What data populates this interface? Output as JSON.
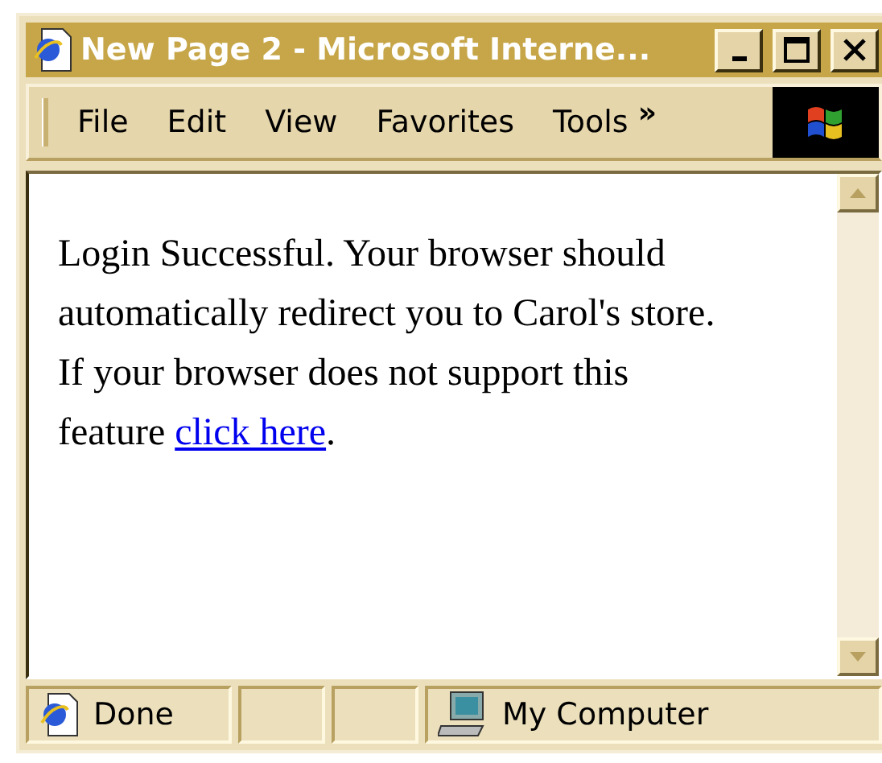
{
  "window": {
    "title": "New Page 2 - Microsoft Interne...",
    "controls": [
      {
        "kind": "minimize"
      },
      {
        "kind": "maximize"
      },
      {
        "kind": "close"
      }
    ]
  },
  "menu": {
    "items": [
      "File",
      "Edit",
      "View",
      "Favorites",
      "Tools"
    ],
    "overflow": "»"
  },
  "content": {
    "text": "Login Successful. Your browser should automatically redirect you to Carol's store. If your browser does not support this feature ",
    "link": "click here",
    "after_link": "."
  },
  "status_bar": {
    "text": "Done",
    "zone": "My Computer"
  }
}
